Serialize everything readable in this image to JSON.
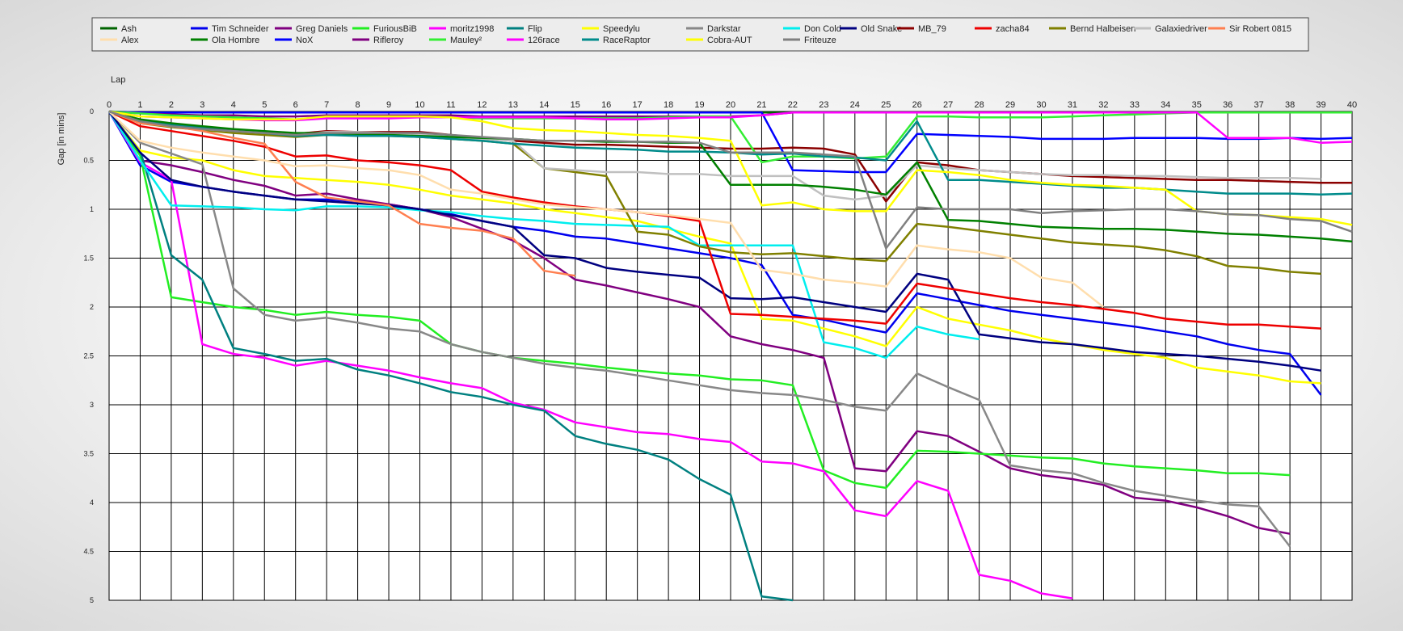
{
  "chart_data": {
    "type": "line",
    "xlabel": "Lap",
    "ylabel": "Gap [in mins]",
    "xlim": [
      0,
      40
    ],
    "ylim": [
      0,
      5
    ],
    "y_inverted": true,
    "grid": true,
    "legend_position": "top",
    "x_ticks": [
      "0",
      "1",
      "2",
      "3",
      "4",
      "5",
      "6",
      "7",
      "8",
      "9",
      "10",
      "11",
      "12",
      "13",
      "14",
      "15",
      "16",
      "17",
      "18",
      "19",
      "20",
      "21",
      "22",
      "23",
      "24",
      "25",
      "26",
      "27",
      "28",
      "29",
      "30",
      "31",
      "32",
      "33",
      "34",
      "35",
      "36",
      "37",
      "38",
      "39",
      "40"
    ],
    "y_ticks": [
      "0",
      "0.5",
      "1",
      "1.5",
      "2",
      "2.5",
      "3",
      "3.5",
      "4",
      "4.5",
      "5"
    ],
    "series": [
      {
        "name": "Ash",
        "color": "#006400",
        "values": [
          0,
          0.01,
          0.01,
          0.01,
          0.01,
          0.01,
          0.01,
          0.01,
          0.01,
          0.01,
          0.01,
          0.01,
          0.01,
          0.01,
          0.01,
          0.01,
          0.01,
          0.01,
          0.01,
          0.01,
          0.01,
          0.01,
          0.01,
          0.01,
          0.01,
          0.01,
          0.01,
          0.01,
          0.01,
          0.01,
          0.01,
          0.01,
          0.01,
          0.01,
          0.01,
          0.01,
          0.01,
          0.01,
          0.01,
          0.01,
          0.01
        ]
      },
      {
        "name": "Tim Schneider",
        "color": "#0000EE",
        "values": [
          0,
          0.55,
          0.72,
          0.77,
          0.82,
          0.86,
          0.9,
          0.9,
          0.92,
          0.95,
          1.0,
          1.05,
          1.12,
          1.18,
          1.22,
          1.28,
          1.3,
          1.35,
          1.4,
          1.45,
          1.5,
          1.57,
          2.08,
          2.13,
          2.2,
          2.26,
          1.86,
          1.92,
          1.98,
          2.04,
          2.08,
          2.12,
          2.16,
          2.2,
          2.25,
          2.3,
          2.38,
          2.44,
          2.48,
          2.9,
          null
        ]
      },
      {
        "name": "Greg Daniels",
        "color": "#800080",
        "values": [
          0,
          0.5,
          0.55,
          0.62,
          0.7,
          0.76,
          0.86,
          0.84,
          0.9,
          0.95,
          1.0,
          1.08,
          1.2,
          1.32,
          1.5,
          1.72,
          1.78,
          1.85,
          1.92,
          2.0,
          2.3,
          2.38,
          2.44,
          2.52,
          3.65,
          3.68,
          3.27,
          3.32,
          3.48,
          3.65,
          3.72,
          3.76,
          3.82,
          3.95,
          3.98,
          4.05,
          4.14,
          4.26,
          4.32,
          null,
          null
        ]
      },
      {
        "name": "FuriousBiB",
        "color": "#22EE22",
        "values": [
          0,
          0.45,
          1.9,
          1.95,
          2.0,
          2.03,
          2.08,
          2.05,
          2.08,
          2.1,
          2.14,
          2.38,
          2.46,
          2.52,
          2.55,
          2.58,
          2.62,
          2.65,
          2.68,
          2.7,
          2.74,
          2.75,
          2.8,
          3.67,
          3.8,
          3.85,
          3.47,
          3.48,
          3.5,
          3.52,
          3.54,
          3.55,
          3.6,
          3.63,
          3.65,
          3.67,
          3.7,
          3.7,
          3.72,
          null,
          null
        ]
      },
      {
        "name": "moritz1998",
        "color": "#FF00FF",
        "values": [
          0,
          0.52,
          0.7,
          2.38,
          2.48,
          2.52,
          2.6,
          2.55,
          2.6,
          2.65,
          2.72,
          2.78,
          2.83,
          2.98,
          3.05,
          3.18,
          3.23,
          3.28,
          3.3,
          3.35,
          3.38,
          3.58,
          3.6,
          3.68,
          4.08,
          4.14,
          3.78,
          3.88,
          4.74,
          4.8,
          4.93,
          4.98,
          null,
          null,
          null,
          null,
          null,
          null,
          null,
          null,
          null
        ]
      },
      {
        "name": "Flip",
        "color": "#008080",
        "values": [
          0,
          0.4,
          1.47,
          1.72,
          2.42,
          2.48,
          2.55,
          2.53,
          2.64,
          2.7,
          2.78,
          2.87,
          2.92,
          3.0,
          3.06,
          3.32,
          3.4,
          3.46,
          3.56,
          3.76,
          3.92,
          4.96,
          5.0,
          null,
          null,
          null,
          null,
          null,
          null,
          null,
          null,
          null,
          null,
          null,
          null,
          null,
          null,
          null,
          null,
          null,
          null
        ]
      },
      {
        "name": "Speedylu",
        "color": "#FFFF00",
        "values": [
          0,
          0.4,
          0.47,
          0.5,
          0.6,
          0.66,
          0.68,
          0.7,
          0.72,
          0.75,
          0.8,
          0.86,
          0.9,
          0.94,
          1.0,
          1.04,
          1.08,
          1.12,
          1.2,
          1.28,
          1.35,
          2.12,
          2.14,
          2.22,
          2.3,
          2.4,
          2.0,
          2.12,
          2.18,
          2.24,
          2.32,
          2.38,
          2.44,
          2.48,
          2.52,
          2.62,
          2.66,
          2.7,
          2.76,
          2.78,
          null
        ]
      },
      {
        "name": "Darkstar",
        "color": "#888888",
        "values": [
          0,
          0.32,
          0.43,
          0.54,
          1.81,
          2.08,
          2.14,
          2.11,
          2.16,
          2.22,
          2.25,
          2.38,
          2.46,
          2.52,
          2.58,
          2.62,
          2.65,
          2.7,
          2.75,
          2.8,
          2.85,
          2.88,
          2.9,
          2.95,
          3.02,
          3.06,
          2.68,
          2.82,
          2.95,
          3.62,
          3.67,
          3.7,
          3.8,
          3.88,
          3.93,
          3.98,
          4.02,
          4.04,
          4.45,
          null,
          null
        ]
      },
      {
        "name": "Don Cold",
        "color": "#00EEEE",
        "values": [
          0,
          0.5,
          0.96,
          0.97,
          0.98,
          1.0,
          1.01,
          0.97,
          0.97,
          0.98,
          1.01,
          1.03,
          1.07,
          1.1,
          1.12,
          1.15,
          1.16,
          1.17,
          1.18,
          1.37,
          1.37,
          1.37,
          1.37,
          2.36,
          2.42,
          2.52,
          2.2,
          2.28,
          2.33,
          null,
          null,
          null,
          null,
          null,
          null,
          null,
          null,
          null,
          null,
          null,
          null
        ]
      },
      {
        "name": "Old Snake",
        "color": "#000080",
        "values": [
          0,
          0.42,
          0.7,
          0.77,
          0.82,
          0.86,
          0.9,
          0.92,
          0.94,
          0.96,
          1.0,
          1.06,
          1.12,
          1.18,
          1.47,
          1.5,
          1.6,
          1.64,
          1.67,
          1.7,
          1.91,
          1.92,
          1.9,
          1.95,
          2.0,
          2.05,
          1.66,
          1.72,
          2.28,
          2.32,
          2.36,
          2.38,
          2.42,
          2.46,
          2.48,
          2.5,
          2.53,
          2.56,
          2.6,
          2.65,
          null
        ]
      },
      {
        "name": "MB_79",
        "color": "#8B0000",
        "values": [
          0,
          0.1,
          0.13,
          0.16,
          0.19,
          0.21,
          0.23,
          0.2,
          0.21,
          0.21,
          0.21,
          0.24,
          0.27,
          0.3,
          0.32,
          0.34,
          0.34,
          0.35,
          0.36,
          0.37,
          0.38,
          0.38,
          0.37,
          0.38,
          0.44,
          0.92,
          0.52,
          0.55,
          0.6,
          0.62,
          0.64,
          0.66,
          0.67,
          0.68,
          0.69,
          0.7,
          0.7,
          0.71,
          0.72,
          0.73,
          0.73
        ]
      },
      {
        "name": "zacha84",
        "color": "#EE0000",
        "values": [
          0,
          0.15,
          0.2,
          0.25,
          0.3,
          0.36,
          0.46,
          0.45,
          0.5,
          0.52,
          0.55,
          0.6,
          0.82,
          0.88,
          0.93,
          0.97,
          1.0,
          1.03,
          1.07,
          1.12,
          2.07,
          2.08,
          2.1,
          2.12,
          2.14,
          2.17,
          1.76,
          1.81,
          1.86,
          1.91,
          1.95,
          1.98,
          2.02,
          2.06,
          2.12,
          2.15,
          2.18,
          2.18,
          2.2,
          2.22,
          null
        ]
      },
      {
        "name": "Bernd Halbeisen",
        "color": "#808000",
        "values": [
          0,
          0.12,
          0.16,
          0.19,
          0.22,
          0.24,
          0.26,
          0.24,
          0.24,
          0.25,
          0.26,
          0.28,
          0.3,
          0.33,
          0.58,
          0.62,
          0.66,
          1.23,
          1.26,
          1.38,
          1.44,
          1.46,
          1.45,
          1.48,
          1.51,
          1.53,
          1.15,
          1.18,
          1.22,
          1.26,
          1.3,
          1.34,
          1.36,
          1.38,
          1.42,
          1.48,
          1.58,
          1.6,
          1.64,
          1.66,
          null
        ]
      },
      {
        "name": "Galaxiedriver",
        "color": "#C0C0C0",
        "values": [
          0,
          0.1,
          0.15,
          0.18,
          0.2,
          0.22,
          0.24,
          0.21,
          0.21,
          0.22,
          0.24,
          0.26,
          0.28,
          0.3,
          0.58,
          0.6,
          0.62,
          0.62,
          0.64,
          0.64,
          0.66,
          0.66,
          0.66,
          0.86,
          0.9,
          0.86,
          0.55,
          0.58,
          0.6,
          0.62,
          0.64,
          0.65,
          0.65,
          0.66,
          0.66,
          0.67,
          0.68,
          0.68,
          0.68,
          0.69,
          null
        ]
      },
      {
        "name": "Sir Robert 0815",
        "color": "#FF7F50",
        "values": [
          0,
          0.12,
          0.15,
          0.2,
          0.27,
          0.33,
          0.72,
          0.88,
          0.92,
          0.96,
          1.15,
          1.19,
          1.22,
          1.3,
          1.63,
          1.68,
          null,
          null,
          null,
          null,
          null,
          null,
          null,
          null,
          null,
          null,
          null,
          null,
          null,
          null,
          null,
          null,
          null,
          null,
          null,
          null,
          null,
          null,
          null,
          null,
          null
        ]
      },
      {
        "name": "Alex",
        "color": "#FFDEAD",
        "values": [
          0,
          0.3,
          0.37,
          0.42,
          0.46,
          0.5,
          0.56,
          0.55,
          0.58,
          0.6,
          0.65,
          0.8,
          0.84,
          0.9,
          0.95,
          0.98,
          1.0,
          1.03,
          1.06,
          1.1,
          1.14,
          1.62,
          1.66,
          1.72,
          1.75,
          1.79,
          1.37,
          1.41,
          1.44,
          1.5,
          1.7,
          1.75,
          2.0,
          null,
          null,
          null,
          null,
          null,
          null,
          null,
          null
        ]
      },
      {
        "name": "Ola Hombre",
        "color": "#008000",
        "values": [
          0,
          0.08,
          0.12,
          0.15,
          0.18,
          0.2,
          0.22,
          0.22,
          0.23,
          0.24,
          0.25,
          0.26,
          0.27,
          0.28,
          0.3,
          0.3,
          0.31,
          0.31,
          0.32,
          0.32,
          0.75,
          0.75,
          0.75,
          0.77,
          0.8,
          0.85,
          0.52,
          1.11,
          1.12,
          1.15,
          1.18,
          1.19,
          1.2,
          1.2,
          1.21,
          1.23,
          1.25,
          1.26,
          1.28,
          1.3,
          1.33
        ]
      },
      {
        "name": "NoX",
        "color": "#0000FF",
        "values": [
          0,
          0.01,
          0.01,
          0.01,
          0.01,
          0.01,
          0.01,
          0.01,
          0.01,
          0.01,
          0.01,
          0.01,
          0.01,
          0.01,
          0.01,
          0.01,
          0.01,
          0.01,
          0.01,
          0.01,
          0.01,
          0.01,
          0.6,
          0.61,
          0.62,
          0.62,
          0.23,
          0.24,
          0.25,
          0.26,
          0.28,
          0.28,
          0.28,
          0.27,
          0.27,
          0.27,
          0.28,
          0.28,
          0.27,
          0.28,
          0.27
        ]
      },
      {
        "name": "Rifleroy",
        "color": "#800080",
        "values": [
          0,
          0.02,
          0.03,
          0.04,
          0.04,
          0.05,
          0.05,
          0.04,
          0.04,
          0.04,
          0.04,
          0.04,
          0.05,
          0.05,
          0.05,
          0.05,
          0.05,
          0.05,
          0.05,
          0.05,
          0.05,
          0.04,
          0.01,
          0.01,
          0.01,
          0.01,
          0.01,
          0.01,
          0.01,
          0.01,
          0.01,
          0.01,
          0.01,
          0.01,
          0.01,
          0.01,
          0.01,
          0.01,
          0.01,
          0.01,
          0.01
        ]
      },
      {
        "name": "Mauley²",
        "color": "#33EE33",
        "values": [
          0,
          0.02,
          0.04,
          0.05,
          0.06,
          0.07,
          0.08,
          0.06,
          0.06,
          0.06,
          0.06,
          0.06,
          0.07,
          0.07,
          0.07,
          0.07,
          0.07,
          0.07,
          0.06,
          0.05,
          0.05,
          0.52,
          0.46,
          0.46,
          0.48,
          0.46,
          0.05,
          0.05,
          0.06,
          0.06,
          0.06,
          0.05,
          0.04,
          0.03,
          0.02,
          0.01,
          0.01,
          0.01,
          0.01,
          0.01,
          0.01
        ]
      },
      {
        "name": "126race",
        "color": "#FF00FF",
        "values": [
          0,
          0.05,
          0.06,
          0.07,
          0.08,
          0.09,
          0.09,
          0.07,
          0.07,
          0.07,
          0.06,
          0.06,
          0.06,
          0.06,
          0.06,
          0.07,
          0.08,
          0.08,
          0.07,
          0.06,
          0.06,
          0.04,
          0.01,
          0.01,
          0.01,
          0.01,
          0.01,
          0.01,
          0.01,
          0.01,
          0.01,
          0.01,
          0.01,
          0.01,
          0.01,
          0.01,
          0.27,
          0.27,
          0.27,
          0.32,
          0.31
        ]
      },
      {
        "name": "RaceRaptor",
        "color": "#008B8B",
        "values": [
          0,
          0.1,
          0.14,
          0.17,
          0.2,
          0.22,
          0.25,
          0.24,
          0.25,
          0.25,
          0.26,
          0.28,
          0.3,
          0.33,
          0.35,
          0.37,
          0.38,
          0.39,
          0.41,
          0.41,
          0.42,
          0.44,
          0.43,
          0.46,
          0.47,
          0.5,
          0.1,
          0.7,
          0.7,
          0.72,
          0.74,
          0.76,
          0.78,
          0.78,
          0.8,
          0.82,
          0.84,
          0.84,
          0.84,
          0.85,
          0.84
        ]
      },
      {
        "name": "Cobra-AUT",
        "color": "#FFFF00",
        "values": [
          0,
          0.05,
          0.06,
          0.07,
          0.08,
          0.08,
          0.08,
          0.05,
          0.05,
          0.05,
          0.05,
          0.06,
          0.1,
          0.17,
          0.19,
          0.2,
          0.22,
          0.24,
          0.25,
          0.27,
          0.3,
          0.96,
          0.93,
          1.0,
          1.02,
          1.02,
          0.6,
          0.62,
          0.65,
          0.7,
          0.73,
          0.75,
          0.76,
          0.78,
          0.8,
          1.02,
          1.05,
          1.06,
          1.08,
          1.1,
          1.16
        ]
      },
      {
        "name": "Friteuze",
        "color": "#808080",
        "values": [
          0,
          0.1,
          0.15,
          0.18,
          0.2,
          0.22,
          0.24,
          0.22,
          0.22,
          0.22,
          0.22,
          0.24,
          0.26,
          0.28,
          0.3,
          0.3,
          0.3,
          0.31,
          0.31,
          0.32,
          0.42,
          0.42,
          0.42,
          0.44,
          0.46,
          1.4,
          0.98,
          1.0,
          1.0,
          1.0,
          1.04,
          1.02,
          1.01,
          1.0,
          1.0,
          1.02,
          1.05,
          1.06,
          1.1,
          1.12,
          1.23
        ]
      }
    ]
  }
}
